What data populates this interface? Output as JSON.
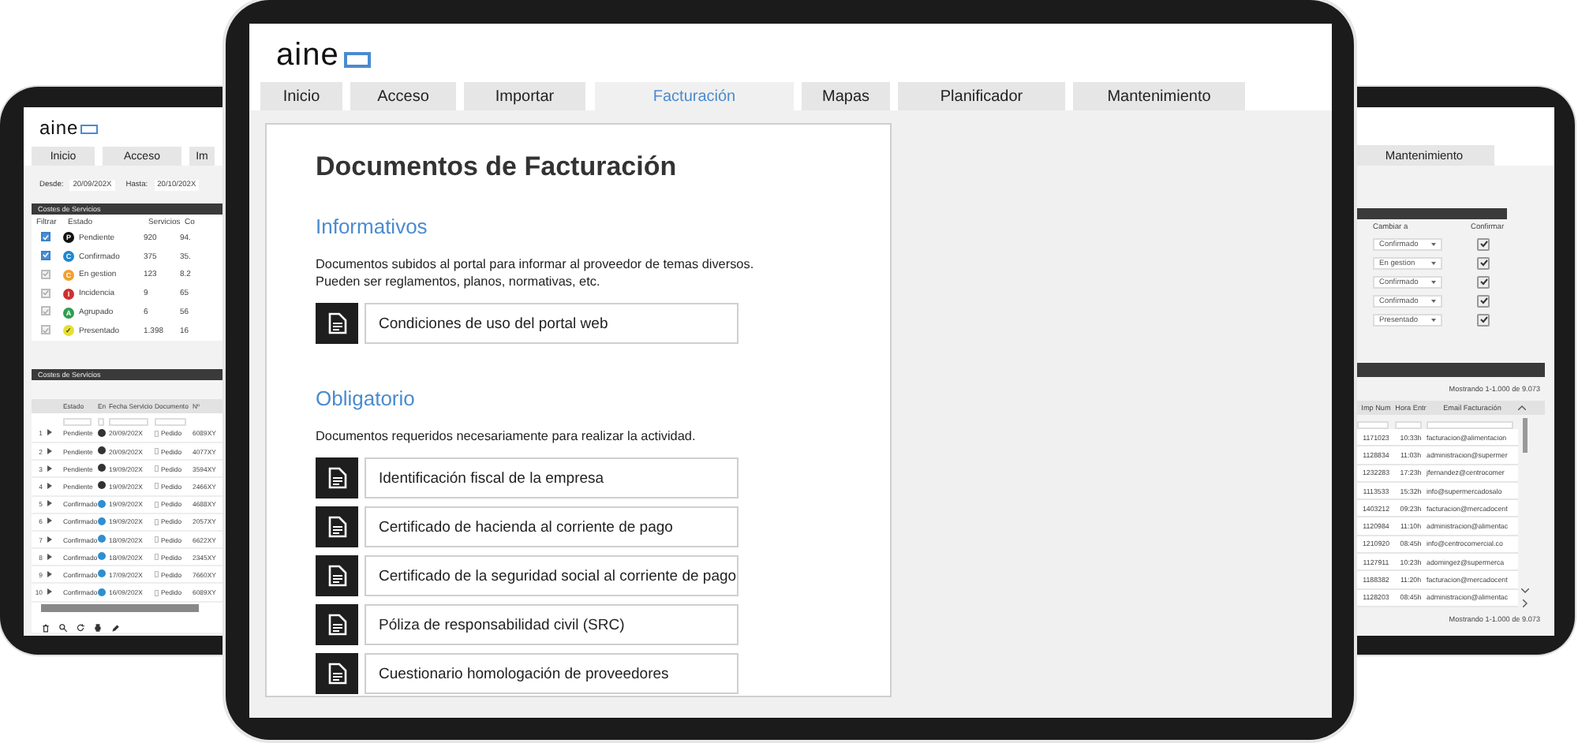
{
  "left_tablet": {
    "logo": "aine",
    "tabs": [
      {
        "label": "Inicio",
        "selected": false
      },
      {
        "label": "Acceso",
        "selected": false
      },
      {
        "label": "Im",
        "selected": false
      }
    ],
    "date_from_label": "Desde:",
    "date_from": "20/09/202X",
    "date_to_label": "Hasta:",
    "date_to": "20/10/202X",
    "summary_panel": {
      "title": "Costes de Servicios",
      "columns": [
        "Filtrar",
        "Estado",
        "Servicios",
        "Co"
      ],
      "rows": [
        {
          "checked": true,
          "badge": "P",
          "color": "#111111",
          "status": "Pendiente",
          "services": "920",
          "cost": "94."
        },
        {
          "checked": true,
          "badge": "C",
          "color": "#1e88d0",
          "status": "Confirmado",
          "services": "375",
          "cost": "35."
        },
        {
          "checked": false,
          "badge": "C",
          "color": "#f0a030",
          "status": "En gestion",
          "services": "123",
          "cost": "8.2"
        },
        {
          "checked": false,
          "badge": "I",
          "color": "#d03030",
          "status": "Incidencia",
          "services": "9",
          "cost": "65"
        },
        {
          "checked": false,
          "badge": "A",
          "color": "#2e9e4e",
          "status": "Agrupado",
          "services": "6",
          "cost": "56"
        },
        {
          "checked": false,
          "badge": "✓",
          "color": "#e6e030",
          "status": "Presentado",
          "services": "1.398",
          "cost": "16"
        }
      ]
    },
    "detail_panel": {
      "title": "Costes de Servicios",
      "columns": [
        "Estado",
        "En",
        "Fecha Servicio",
        "Documento",
        "Nº"
      ],
      "rows": [
        {
          "index": "1",
          "status": "Pendiente",
          "color": "#333333",
          "date": "20/09/202X",
          "document": "Pedido",
          "number": "6089XY"
        },
        {
          "index": "2",
          "status": "Pendiente",
          "color": "#333333",
          "date": "20/09/202X",
          "document": "Pedido",
          "number": "4077XY"
        },
        {
          "index": "3",
          "status": "Pendiente",
          "color": "#333333",
          "date": "19/09/202X",
          "document": "Pedido",
          "number": "3594XY"
        },
        {
          "index": "4",
          "status": "Pendiente",
          "color": "#333333",
          "date": "19/09/202X",
          "document": "Pedido",
          "number": "2466XY"
        },
        {
          "index": "5",
          "status": "Confirmado",
          "color": "#2f8fd0",
          "date": "19/09/202X",
          "document": "Pedido",
          "number": "4688XY"
        },
        {
          "index": "6",
          "status": "Confirmado",
          "color": "#2f8fd0",
          "date": "19/09/202X",
          "document": "Pedido",
          "number": "2057XY"
        },
        {
          "index": "7",
          "status": "Confirmado",
          "color": "#2f8fd0",
          "date": "18/09/202X",
          "document": "Pedido",
          "number": "6622XY"
        },
        {
          "index": "8",
          "status": "Confirmado",
          "color": "#2f8fd0",
          "date": "18/09/202X",
          "document": "Pedido",
          "number": "2345XY"
        },
        {
          "index": "9",
          "status": "Confirmado",
          "color": "#2f8fd0",
          "date": "17/09/202X",
          "document": "Pedido",
          "number": "7660XY"
        },
        {
          "index": "10",
          "status": "Confirmado",
          "color": "#2f8fd0",
          "date": "16/09/202X",
          "document": "Pedido",
          "number": "6089XY"
        }
      ]
    }
  },
  "main": {
    "logo": "aine",
    "tabs": [
      {
        "label": "Inicio",
        "selected": false
      },
      {
        "label": "Acceso",
        "selected": false
      },
      {
        "label": "Importar",
        "selected": false
      },
      {
        "label": "Facturación",
        "selected": true
      },
      {
        "label": "Mapas",
        "selected": false
      },
      {
        "label": "Planificador",
        "selected": false
      },
      {
        "label": "Mantenimiento",
        "selected": false
      }
    ],
    "title": "Documentos de Facturación",
    "sections": [
      {
        "heading": "Informativos",
        "description": [
          "Documentos subidos al portal para informar al proveedor de temas diversos.",
          "Pueden ser reglamentos, planos, normativas, etc."
        ],
        "documents": [
          "Condiciones de uso del portal web"
        ]
      },
      {
        "heading": "Obligatorio",
        "description": [
          "Documentos requeridos necesariamente para realizar la actividad."
        ],
        "documents": [
          "Identificación fiscal de la empresa",
          "Certificado de hacienda al corriente de pago",
          "Certificado de la seguridad social al corriente de pago",
          "Póliza de responsabilidad civil (SRC)",
          "Cuestionario homologación de proveedores"
        ]
      }
    ]
  },
  "right_tablet": {
    "tabs": [
      {
        "label": "Mantenimiento",
        "selected": false
      }
    ],
    "change_panel": {
      "columns": [
        "Cambiar a",
        "Confirmar"
      ],
      "rows": [
        {
          "value": "Confirmado",
          "checked": true
        },
        {
          "value": "En gestion",
          "checked": true
        },
        {
          "value": "Confirmado",
          "checked": true
        },
        {
          "value": "Confirmado",
          "checked": true
        },
        {
          "value": "Presentado",
          "checked": true
        }
      ]
    },
    "list_panel": {
      "summary": "Mostrando 1-1.000 de 9.073",
      "columns": [
        "Imp Num",
        "Hora Entr",
        "Email Facturación"
      ],
      "rows": [
        [
          "1171023",
          "10:33h",
          "facturacion@alimentacion"
        ],
        [
          "1128834",
          "11:03h",
          "administracion@supermer"
        ],
        [
          "1232283",
          "17:23h",
          "jfernandez@centrocomer"
        ],
        [
          "1113533",
          "15:32h",
          "info@supermercadosalo"
        ],
        [
          "1403212",
          "09:23h",
          "facturacion@mercadocent"
        ],
        [
          "1120984",
          "11:10h",
          "administracion@alimentac"
        ],
        [
          "1210920",
          "08:45h",
          "info@centrocomercial.co"
        ],
        [
          "1127911",
          "10:23h",
          "adomingez@supermerca"
        ],
        [
          "1188382",
          "11:20h",
          "facturacion@mercadocent"
        ],
        [
          "1128203",
          "08:45h",
          "administracion@alimentac"
        ]
      ],
      "footer": "Mostrando 1-1.000 de 9.073"
    }
  }
}
